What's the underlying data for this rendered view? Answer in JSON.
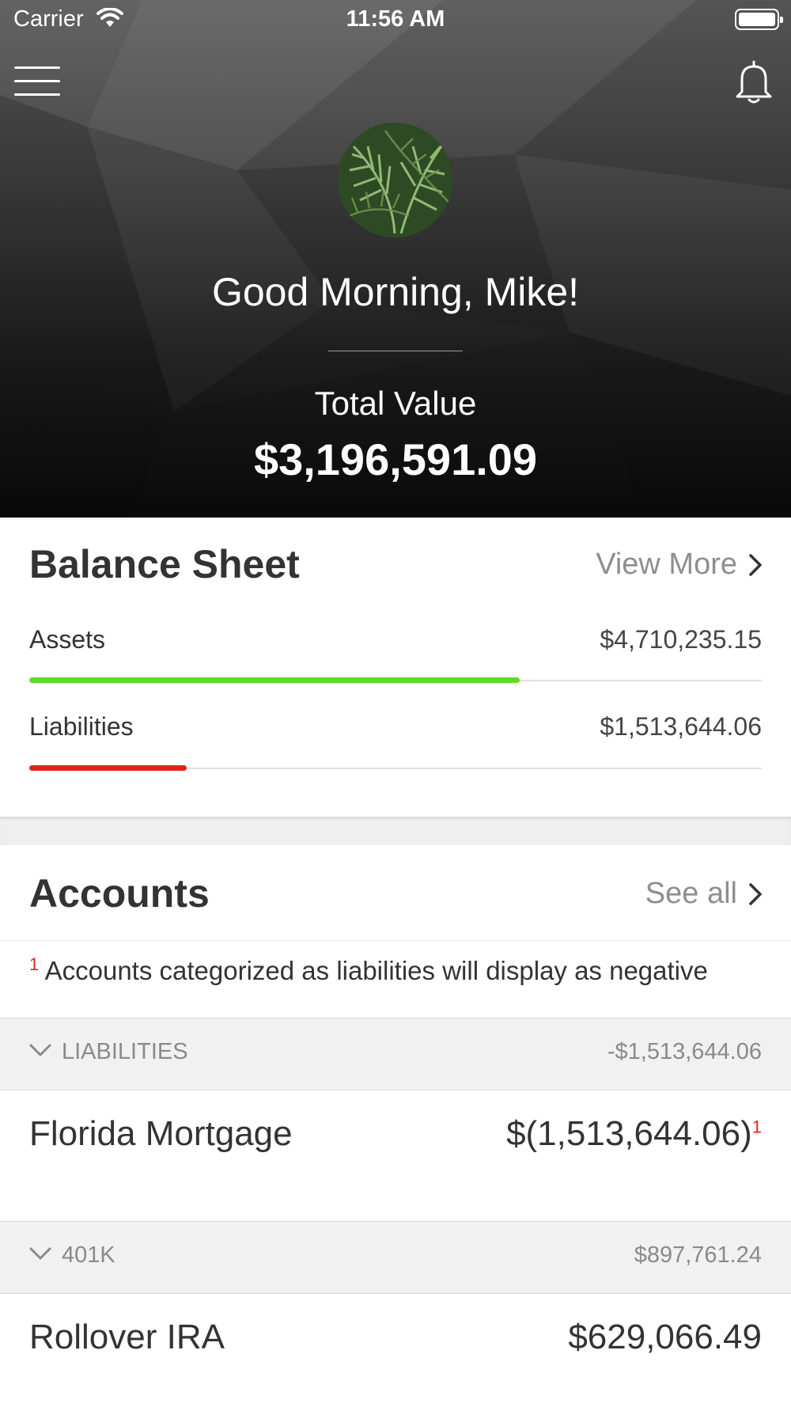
{
  "status_bar": {
    "carrier": "Carrier",
    "time": "11:56 AM"
  },
  "header": {
    "greeting": "Good Morning, Mike!",
    "total_label": "Total Value",
    "total_value": "$3,196,591.09"
  },
  "balance_sheet": {
    "title": "Balance Sheet",
    "view_more": "View More",
    "assets": {
      "label": "Assets",
      "value": "$4,710,235.15",
      "fill": 0.67,
      "color": "#62d926"
    },
    "liabilities": {
      "label": "Liabilities",
      "value": "$1,513,644.06",
      "fill": 0.215,
      "color": "#e0261b"
    }
  },
  "accounts": {
    "title": "Accounts",
    "see_all": "See all",
    "footnote_mark": "1",
    "footnote": "Accounts categorized as liabilities will display as negative",
    "groups": [
      {
        "name": "LIABILITIES",
        "total": "-$1,513,644.06",
        "items": [
          {
            "name": "Florida Mortgage",
            "value": "$(1,513,644.06)",
            "mark": "1"
          }
        ]
      },
      {
        "name": "401K",
        "total": "$897,761.24",
        "items": [
          {
            "name": "Rollover IRA",
            "value": "$629,066.49"
          }
        ]
      }
    ]
  },
  "icons": [
    "wifi-icon",
    "battery-icon",
    "hamburger-menu-icon",
    "bell-icon",
    "chevron-right-icon",
    "chevron-down-icon"
  ]
}
